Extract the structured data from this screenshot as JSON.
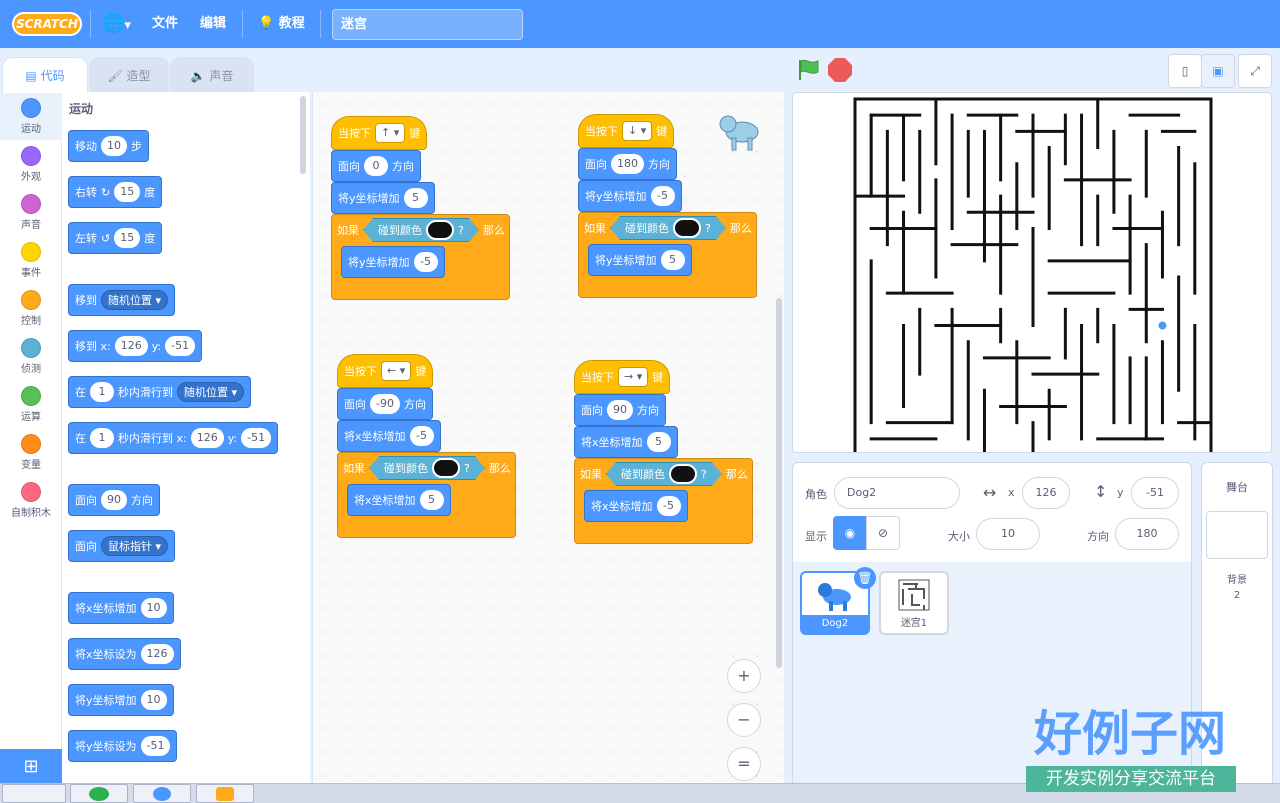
{
  "menu": {
    "logo": "SCRATCH",
    "lang_arrow": "▾",
    "file": "文件",
    "edit": "编辑",
    "tutorials": "教程",
    "project_title": "迷宫"
  },
  "tabs": {
    "code": "代码",
    "costumes": "造型",
    "sounds": "声音"
  },
  "categories": [
    {
      "label": "运动",
      "color": "#4c97ff"
    },
    {
      "label": "外观",
      "color": "#9966ff"
    },
    {
      "label": "声音",
      "color": "#cf63cf"
    },
    {
      "label": "事件",
      "color": "#ffd500"
    },
    {
      "label": "控制",
      "color": "#ffab19"
    },
    {
      "label": "侦测",
      "color": "#5cb1d6"
    },
    {
      "label": "运算",
      "color": "#59c059"
    },
    {
      "label": "变量",
      "color": "#ff8c1a"
    },
    {
      "label": "自制积木",
      "color": "#ff6680"
    }
  ],
  "palette": {
    "heading": "运动",
    "move": {
      "a": "移动",
      "v": "10",
      "b": "步"
    },
    "turn_right": {
      "a": "右转",
      "v": "15",
      "b": "度"
    },
    "turn_left": {
      "a": "左转",
      "v": "15",
      "b": "度"
    },
    "goto": {
      "a": "移到",
      "dd": "随机位置"
    },
    "goto_xy": {
      "a": "移到 x:",
      "x": "126",
      "b": "y:",
      "y": "-51"
    },
    "glide": {
      "a": "在",
      "v": "1",
      "b": "秒内滑行到",
      "dd": "随机位置"
    },
    "glide_xy": {
      "a": "在",
      "v": "1",
      "b": "秒内滑行到 x:",
      "x": "126",
      "c": "y:",
      "y": "-51"
    },
    "point_dir": {
      "a": "面向",
      "v": "90",
      "b": "方向"
    },
    "point_towards": {
      "a": "面向",
      "dd": "鼠标指针"
    },
    "change_x": {
      "a": "将x坐标增加",
      "v": "10"
    },
    "set_x": {
      "a": "将x坐标设为",
      "v": "126"
    },
    "change_y": {
      "a": "将y坐标增加",
      "v": "10"
    },
    "set_y": {
      "a": "将y坐标设为",
      "v": "-51"
    }
  },
  "scripts": [
    {
      "key_a": "当按下",
      "key": "↑",
      "key_b": "键",
      "dir_a": "面向",
      "dir": "0",
      "dir_b": "方向",
      "chg": "将y坐标增加",
      "chg_v": "5",
      "if": "如果",
      "touch": "碰到颜色",
      "q": "?",
      "then": "那么",
      "inner": "将y坐标增加",
      "inner_v": "-5"
    },
    {
      "key_a": "当按下",
      "key": "↓",
      "key_b": "键",
      "dir_a": "面向",
      "dir": "180",
      "dir_b": "方向",
      "chg": "将y坐标增加",
      "chg_v": "-5",
      "if": "如果",
      "touch": "碰到颜色",
      "q": "?",
      "then": "那么",
      "inner": "将y坐标增加",
      "inner_v": "5"
    },
    {
      "key_a": "当按下",
      "key": "←",
      "key_b": "键",
      "dir_a": "面向",
      "dir": "-90",
      "dir_b": "方向",
      "chg": "将x坐标增加",
      "chg_v": "-5",
      "if": "如果",
      "touch": "碰到颜色",
      "q": "?",
      "then": "那么",
      "inner": "将x坐标增加",
      "inner_v": "5"
    },
    {
      "key_a": "当按下",
      "key": "→",
      "key_b": "键",
      "dir_a": "面向",
      "dir": "90",
      "dir_b": "方向",
      "chg": "将x坐标增加",
      "chg_v": "5",
      "if": "如果",
      "touch": "碰到颜色",
      "q": "?",
      "then": "那么",
      "inner": "将x坐标增加",
      "inner_v": "-5"
    }
  ],
  "zoom": {
    "in": "+",
    "out": "−",
    "reset": "="
  },
  "sprite_info": {
    "sprite_label": "角色",
    "sprite_name": "Dog2",
    "x_label": "x",
    "x": "126",
    "y_label": "y",
    "y": "-51",
    "show_label": "显示",
    "size_label": "大小",
    "size": "10",
    "dir_label": "方向",
    "dir": "180"
  },
  "sprites": [
    {
      "name": "Dog2"
    },
    {
      "name": "迷宫1"
    }
  ],
  "stage_panel": {
    "title": "舞台",
    "backdrops_label": "背景",
    "backdrops_count": "2"
  },
  "watermark": {
    "title": "好例子网",
    "subtitle": "开发实例分享交流平台"
  },
  "colors": {
    "motion": "#4c97ff",
    "events": "#ffbf00",
    "control": "#ffab19",
    "sensing": "#5cb1d6",
    "menubar": "#4c97ff"
  }
}
